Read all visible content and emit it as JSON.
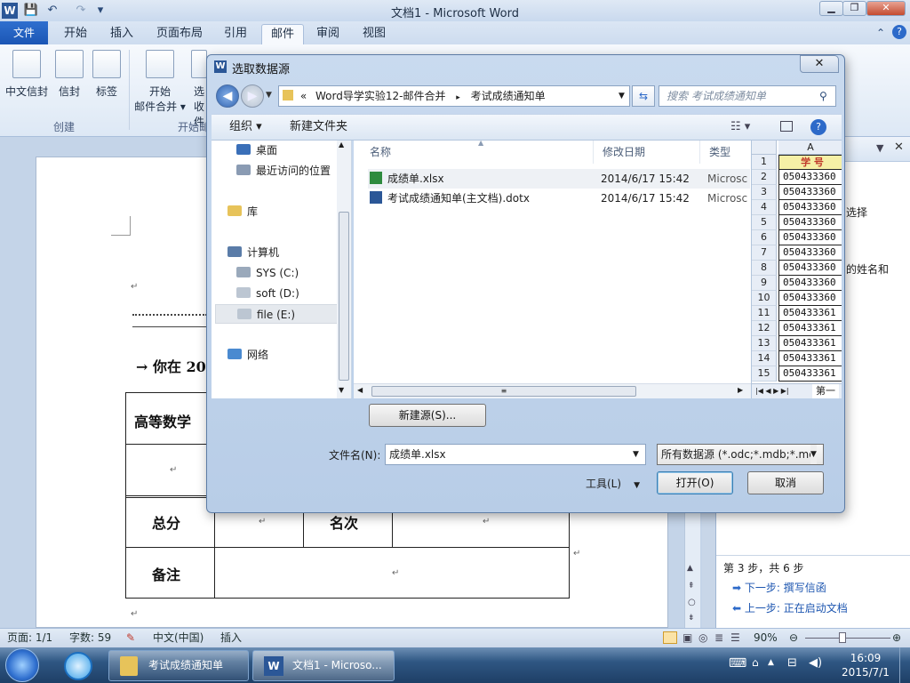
{
  "window": {
    "title": "文档1  -  Microsoft Word"
  },
  "qat": {
    "save": "💾",
    "undo": "↶",
    "redo": "↷",
    "customize": "▾"
  },
  "ribbon_tabs": [
    "文件",
    "开始",
    "插入",
    "页面布局",
    "引用",
    "邮件",
    "审阅",
    "视图"
  ],
  "ribbon": {
    "buttons": [
      "中文信封",
      "信封",
      "标签",
      "开始",
      "邮件合并 ▾",
      "选",
      "收件"
    ],
    "groups": [
      "创建",
      "开始邮件合"
    ]
  },
  "dialog": {
    "title": "选取数据源",
    "close": "✕",
    "address": {
      "prefix": "«",
      "path1": "Word导学实验12-邮件合并",
      "sep": "▸",
      "path2": "考试成绩通知单"
    },
    "search_placeholder": "搜索 考试成绩通知单",
    "cmd": {
      "organize": "组织 ▾",
      "new_folder": "新建文件夹"
    },
    "nav": [
      "桌面",
      "最近访问的位置",
      "库",
      "计算机",
      "SYS (C:)",
      "soft (D:)",
      "file (E:)",
      "网络"
    ],
    "columns": {
      "name": "名称",
      "date": "修改日期",
      "type": "类型"
    },
    "files": [
      {
        "name": "成绩单.xlsx",
        "date": "2014/6/17 15:42",
        "type": "Microsc"
      },
      {
        "name": "考试成绩通知单(主文档).dotx",
        "date": "2014/6/17 15:42",
        "type": "Microsc"
      }
    ],
    "preview": {
      "col": "A",
      "header": "学  号",
      "rows": [
        "1",
        "2",
        "3",
        "4",
        "5",
        "6",
        "7",
        "8",
        "9",
        "10",
        "11",
        "12",
        "13",
        "14",
        "15"
      ],
      "values": [
        "050433360",
        "050433360",
        "050433360",
        "050433360",
        "050433360",
        "050433360",
        "050433360",
        "050433360",
        "050433360",
        "050433361",
        "050433361",
        "050433361",
        "050433361",
        "050433361"
      ],
      "sheet": "第一"
    },
    "new_source": "新建源(S)...",
    "filename_label": "文件名(N):",
    "filename_value": "成绩单.xlsx",
    "filter": "所有数据源 (*.odc;*.mdb;*.md",
    "tools": "工具(L)",
    "open": "打开(O)",
    "cancel": "取消"
  },
  "document": {
    "line1": "→ 你在 20",
    "table": {
      "r1c1": "高等数学",
      "r3c1": "总分",
      "r3c3": "名次",
      "r4c1": "备注"
    }
  },
  "taskpane": {
    "text1": "选择",
    "text2": "的姓名和",
    "step": "第 3 步，共 6 步",
    "next": "下一步: 撰写信函",
    "prev": "上一步: 正在启动文档"
  },
  "status": {
    "page": "页面: 1/1",
    "words": "字数: 59",
    "lang": "中文(中国)",
    "mode": "插入",
    "zoom": "90%"
  },
  "taskbar": {
    "item1": "考试成绩通知单",
    "item2": "文档1 - Microso...",
    "time": "16:09",
    "date": "2015/7/1"
  }
}
